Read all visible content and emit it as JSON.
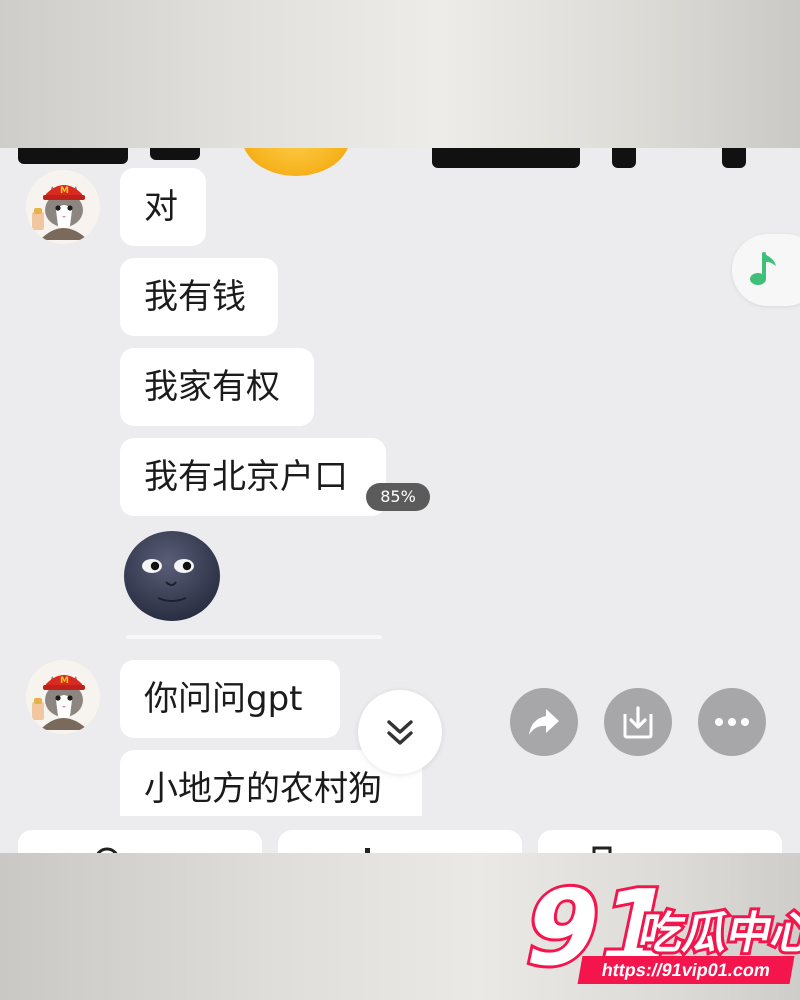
{
  "messages": {
    "group1": [
      "对",
      "我有钱",
      "我家有权",
      "我有北京户口"
    ],
    "group2": [
      "你问问gpt",
      "小地方的农村狗"
    ]
  },
  "overlay": {
    "percent_badge": "85%"
  },
  "icons": {
    "music": "music-note-icon",
    "scroll": "chevron-double-down-icon",
    "share": "share-icon",
    "download": "download-icon",
    "more": "more-icon"
  },
  "watermark": {
    "number": "91",
    "brand": "吃瓜中心",
    "url": "https://91vip01.com"
  },
  "colors": {
    "accent": "#f4154d",
    "music_green": "#3ec07a",
    "chat_bg": "#ececee",
    "bubble": "#ffffff"
  }
}
